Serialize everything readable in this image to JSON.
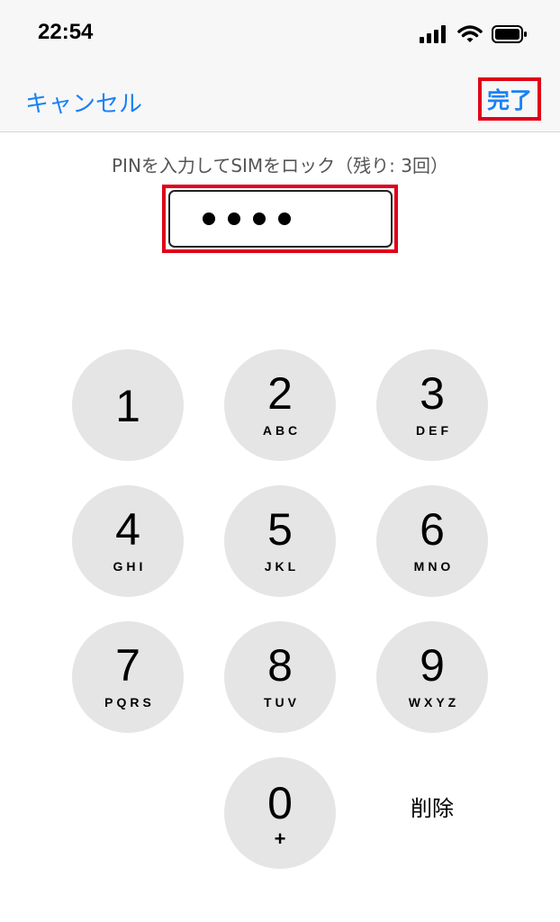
{
  "status_bar": {
    "time": "22:54"
  },
  "nav": {
    "cancel_label": "キャンセル",
    "done_label": "完了"
  },
  "prompt": {
    "text": "PINを入力してSIMをロック（残り: 3回）"
  },
  "pin": {
    "entered_digits": 4
  },
  "keypad": {
    "keys": [
      {
        "num": "1",
        "letters": ""
      },
      {
        "num": "2",
        "letters": "ABC"
      },
      {
        "num": "3",
        "letters": "DEF"
      },
      {
        "num": "4",
        "letters": "GHI"
      },
      {
        "num": "5",
        "letters": "JKL"
      },
      {
        "num": "6",
        "letters": "MNO"
      },
      {
        "num": "7",
        "letters": "PQRS"
      },
      {
        "num": "8",
        "letters": "TUV"
      },
      {
        "num": "9",
        "letters": "WXYZ"
      },
      {
        "num": "0",
        "letters": "+"
      }
    ],
    "delete_label": "削除"
  },
  "colors": {
    "accent": "#1a82f5",
    "highlight": "#e0001a",
    "key_bg": "#e5e5e5"
  },
  "icons": [
    "signal-icon",
    "wifi-icon",
    "battery-icon"
  ]
}
